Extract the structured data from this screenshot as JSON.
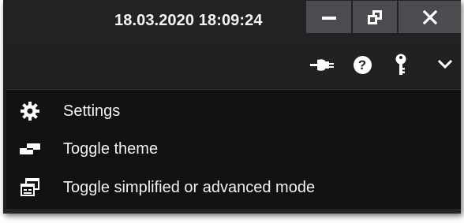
{
  "titlebar": {
    "datetime": "18.03.2020 18:09:24",
    "buttons": {
      "minimize": "minimize-icon",
      "maximize": "restore-icon",
      "close": "close-icon"
    }
  },
  "toolbar": {
    "icons": [
      "plug-icon",
      "help-icon",
      "key-icon",
      "chevron-down-icon"
    ],
    "help_glyph": "?"
  },
  "menu": {
    "items": [
      {
        "label": "Settings",
        "icon": "gear-icon"
      },
      {
        "label": "Toggle theme",
        "icon": "toggle-theme-icon"
      },
      {
        "label": "Toggle simplified or advanced mode",
        "icon": "mode-windows-icon"
      }
    ]
  },
  "colors": {
    "window_bg": "#1b1d1f",
    "titlebar_button_bg": "#4a4c4f",
    "menu_bg": "#101112",
    "text": "#f2f2f2"
  }
}
